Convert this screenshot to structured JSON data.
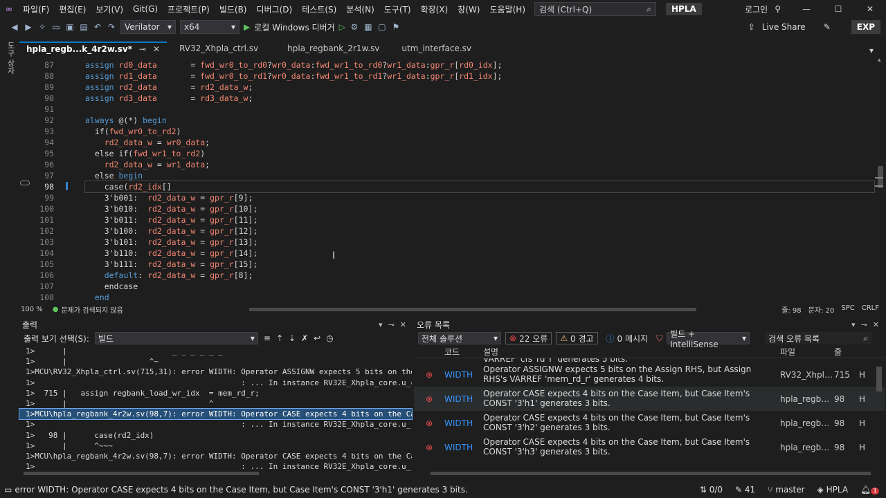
{
  "menu": {
    "items": [
      "파일(F)",
      "편집(E)",
      "보기(V)",
      "Git(G)",
      "프로젝트(P)",
      "빌드(B)",
      "디버그(D)",
      "테스트(S)",
      "분석(N)",
      "도구(T)",
      "확장(X)",
      "창(W)",
      "도움말(H)"
    ],
    "search_label": "검색 (Ctrl+Q)",
    "solution_name": "HPLA",
    "login_label": "로그인"
  },
  "toolbar": {
    "config_value": "Verilator",
    "platform_value": "x64",
    "debugger_label": "로컬 Windows 디버거",
    "live_share_label": "Live Share",
    "exp_label": "EXP"
  },
  "leftstrip": {
    "label": "도구 상자"
  },
  "tabs": [
    {
      "label": "hpla_regb...k_4r2w.sv*",
      "active": true
    },
    {
      "label": "RV32_Xhpla_ctrl.sv",
      "active": false
    },
    {
      "label": "hpla_regbank_2r1w.sv",
      "active": false
    },
    {
      "label": "utm_interface.sv",
      "active": false
    }
  ],
  "editor": {
    "line_numbers": [
      "87",
      "88",
      "89",
      "90",
      "91",
      "92",
      "93",
      "94",
      "95",
      "96",
      "97",
      "98",
      "99",
      "100",
      "101",
      "102",
      "103",
      "104",
      "105",
      "106",
      "107",
      "108"
    ],
    "current_line": "98",
    "zoom": "100 %",
    "issues_label": "문제가 검색되지 않음",
    "line_label": "줄: 98",
    "char_label": "문자: 20",
    "spc_label": "SPC",
    "crlf_label": "CRLF"
  },
  "output": {
    "title": "출력",
    "source_label": "출력 보기 선택(S):",
    "source_value": "빌드",
    "lines": [
      "1>      |                       _ _ _ _ _ _",
      "1>      |                  ^~",
      "1>MCU\\RV32_Xhpla_ctrl.sv(715,31): error WIDTH: Operator ASSIGNW expects 5 bits on the",
      "1>                                             : ... In instance RV32E_Xhpla_core.u_c",
      "1>  715 |   assign regbank_load_wr_idx  = mem_rd_r;",
      "1>      |                               ^",
      "1>MCU\\hpla_regbank_4r2w.sv(98,7): error WIDTH: Operator CASE expects 4 bits on the Ca",
      "1>                                             : ... In instance RV32E_Xhpla_core.u_r",
      "1>   98 |      case(rd2_idx)",
      "1>      |      ^~~~",
      "1>MCU\\hpla_regbank_4r2w.sv(98,7): error WIDTH: Operator CASE expects 4 bits on the Ca",
      "1>                                             : ... In instance RV32E_Xhpla_core.u_r"
    ],
    "selected_index": 6
  },
  "errors": {
    "title": "오류 목록",
    "scope_value": "전체 솔루션",
    "error_count": "22 오류",
    "warning_count": "0 경고",
    "message_count": "0 메시지",
    "source_value": "빌드 + IntelliSense",
    "search_label": "검색 오류 목록",
    "col_code": "코드",
    "col_desc": "설명",
    "col_file": "파일",
    "col_line": "줄",
    "partial_row": "VARREF 'cfs_rd_r' generates 5 bits.",
    "rows": [
      {
        "code": "WIDTH",
        "desc": "Operator ASSIGNW expects 5 bits on the Assign RHS, but Assign RHS's VARREF 'mem_rd_r' generates 4 bits.",
        "file": "RV32_Xhpla_...",
        "line": "715"
      },
      {
        "code": "WIDTH",
        "desc": "Operator CASE expects 4 bits on the Case Item, but Case Item's CONST '3'h1' generates 3 bits.",
        "file": "hpla_regban...",
        "line": "98"
      },
      {
        "code": "WIDTH",
        "desc": "Operator CASE expects 4 bits on the Case Item, but Case Item's CONST '3'h2' generates 3 bits.",
        "file": "hpla_regban...",
        "line": "98"
      },
      {
        "code": "WIDTH",
        "desc": "Operator CASE expects 4 bits on the Case Item, but Case Item's CONST '3'h3' generates 3 bits.",
        "file": "hpla_regban...",
        "line": "98"
      }
    ],
    "selected_index": 1
  },
  "statusbar": {
    "message": "error WIDTH: Operator CASE expects 4 bits on the Case Item, but Case Item's CONST '3'h1' generates 3 bits.",
    "sync": "0/0",
    "edits": "41",
    "branch": "master",
    "repo": "HPLA",
    "notifications": "1"
  }
}
